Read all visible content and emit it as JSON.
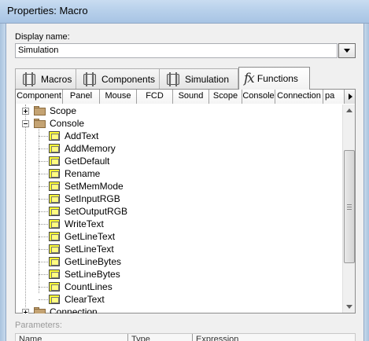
{
  "window": {
    "title": "Properties: Macro"
  },
  "display_name": {
    "label": "Display name:",
    "value": "Simulation"
  },
  "tabs": [
    {
      "label": "Macros",
      "icon": "component-icon",
      "active": false
    },
    {
      "label": "Components",
      "icon": "component-icon",
      "active": false
    },
    {
      "label": "Simulation",
      "icon": "component-icon",
      "active": false
    },
    {
      "label": "Functions",
      "icon": "fx-icon",
      "active": true
    }
  ],
  "columns": [
    "Component",
    "Panel",
    "Mouse",
    "FCD",
    "Sound",
    "Scope",
    "Console",
    "Connection",
    "pa"
  ],
  "tree": {
    "groups": [
      {
        "label": "Scope",
        "expanded": false
      },
      {
        "label": "Console",
        "expanded": true
      },
      {
        "label": "Connection",
        "expanded": false
      }
    ],
    "console_items": [
      "AddText",
      "AddMemory",
      "GetDefault",
      "Rename",
      "SetMemMode",
      "SetInputRGB",
      "SetOutputRGB",
      "WriteText",
      "GetLineText",
      "SetLineText",
      "GetLineBytes",
      "SetLineBytes",
      "CountLines",
      "ClearText"
    ]
  },
  "parameters": {
    "label": "Parameters:",
    "columns": [
      "Name",
      "Type",
      "Expression"
    ]
  }
}
